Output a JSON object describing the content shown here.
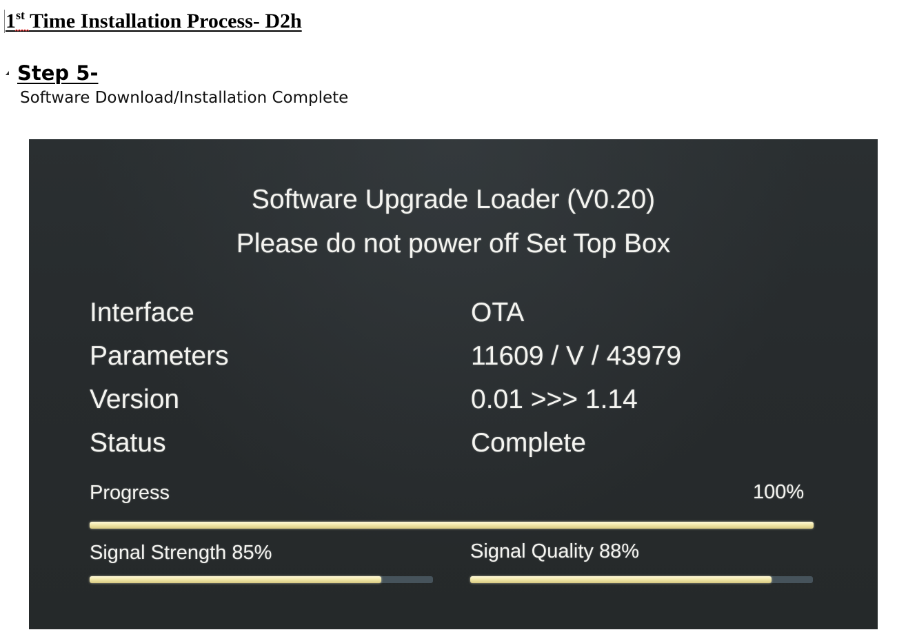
{
  "document": {
    "title_prefix": "1",
    "title_sup": "st",
    "title_rest": " Time Installation Process- D2h",
    "step_heading": "Step 5-",
    "step_description": "Software Download/Installation Complete"
  },
  "screen": {
    "loader_title": "Software Upgrade Loader (V0.20)",
    "warning": "Please do not power off Set Top Box",
    "info_rows": [
      {
        "label": "Interface",
        "value": "OTA"
      },
      {
        "label": "Parameters",
        "value": "11609 / V / 43979"
      },
      {
        "label": "Version",
        "value": "0.01 >>> 1.14"
      },
      {
        "label": "Status",
        "value": "Complete"
      }
    ],
    "progress": {
      "label": "Progress",
      "percent_text": "100%",
      "fraction": 1.0
    },
    "signal_strength": {
      "label": "Signal Strength  85%",
      "fraction": 0.85
    },
    "signal_quality": {
      "label": "Signal Quality 88%",
      "fraction": 0.88
    },
    "colors": {
      "screen_background": "#272b2d",
      "text": "#f4f4f0",
      "bar_fill": "#f1e6a6",
      "bar_track": "#46535b"
    }
  }
}
